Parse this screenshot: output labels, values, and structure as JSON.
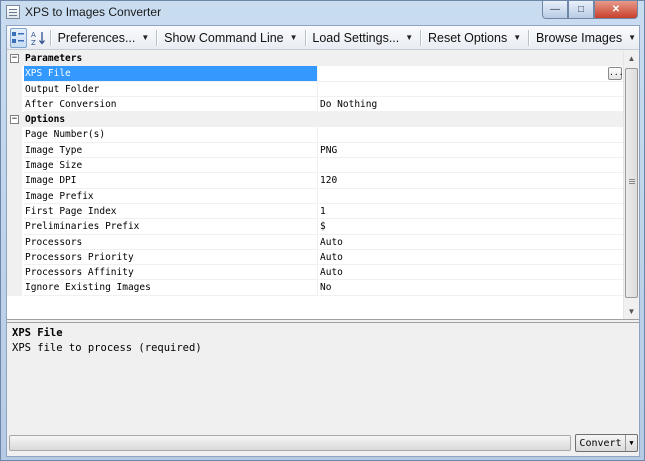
{
  "window": {
    "title": "XPS to Images Converter",
    "minimize_glyph": "—",
    "maximize_glyph": "□",
    "close_glyph": "✕"
  },
  "toolbar": {
    "categorized_icon": "categorized-view-icon",
    "alphabetical_icon": "alphabetical-sort-icon",
    "items": [
      {
        "label": "Preferences..."
      },
      {
        "label": "Show Command Line"
      },
      {
        "label": "Load Settings..."
      },
      {
        "label": "Reset Options"
      },
      {
        "label": "Browse Images"
      }
    ]
  },
  "grid": {
    "categories": [
      {
        "name": "Parameters",
        "toggle": "−",
        "properties": [
          {
            "name": "XPS File",
            "value": ""
          },
          {
            "name": "Output Folder",
            "value": ""
          },
          {
            "name": "After Conversion",
            "value": "Do Nothing"
          }
        ]
      },
      {
        "name": "Options",
        "toggle": "−",
        "properties": [
          {
            "name": "Page Number(s)",
            "value": ""
          },
          {
            "name": "Image Type",
            "value": "PNG"
          },
          {
            "name": "Image Size",
            "value": ""
          },
          {
            "name": "Image DPI",
            "value": "120"
          },
          {
            "name": "Image Prefix",
            "value": ""
          },
          {
            "name": "First Page Index",
            "value": "1"
          },
          {
            "name": "Preliminaries Prefix",
            "value": "$"
          },
          {
            "name": "Processors",
            "value": "Auto"
          },
          {
            "name": "Processors Priority",
            "value": "Auto"
          },
          {
            "name": "Processors Affinity",
            "value": "Auto"
          },
          {
            "name": "Ignore Existing Images",
            "value": "No"
          }
        ]
      }
    ],
    "ellipsis_label": "..."
  },
  "description": {
    "title": "XPS File",
    "text": "XPS file to process (required)"
  },
  "bottom": {
    "progress": 0,
    "convert_label": "Convert"
  }
}
